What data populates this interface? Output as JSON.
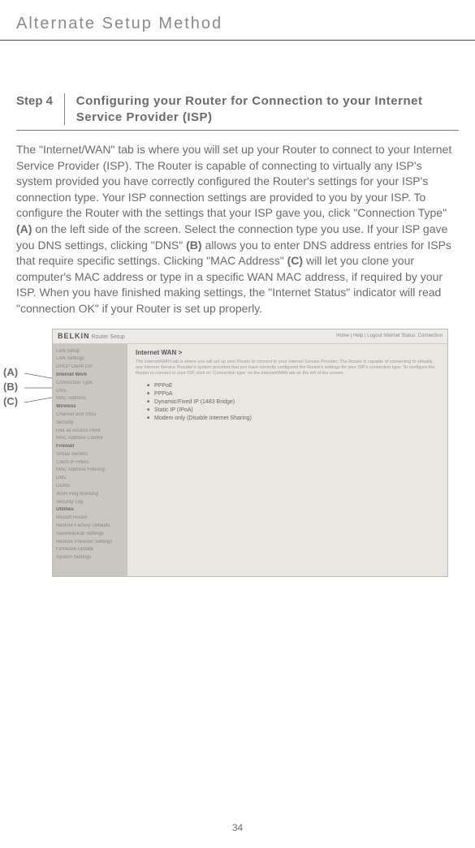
{
  "header": "Alternate Setup Method",
  "step_label": "Step 4",
  "step_title": "Configuring your Router for Connection to your Internet Service Provider (ISP)",
  "paragraph": "The \"Internet/WAN\" tab is where you will set up your Router to connect to your Internet Service Provider (ISP). The Router is capable of connecting to virtually any ISP's system provided you have correctly configured the Router's settings for your ISP's connection type. Your ISP connection settings are provided to you by your ISP. To configure the Router with the settings that your ISP gave you, click \"Connection Type\" ",
  "tagA": "(A)",
  "paragraph2": " on the left side of the screen. Select the connection type you use. If your ISP gave you DNS settings, clicking \"DNS\" ",
  "tagB": "(B)",
  "paragraph3": " allows you to enter DNS address entries for ISPs that require specific settings. Clicking \"MAC Address\" ",
  "tagC": "(C)",
  "paragraph4": " will let you clone your computer's MAC address or type in a specific WAN MAC address, if required by your ISP. When you have finished making settings, the \"Internet Status\" indicator will read \"connection OK\" if your Router is set up properly.",
  "callouts": {
    "a": "(A)",
    "b": "(B)",
    "c": "(C)"
  },
  "screenshot": {
    "brand": "BELKIN",
    "sub_brand": "Router Setup",
    "top_links": "Home | Help | Logout   Internet Status: Connection",
    "nav": [
      "LAN Setup",
      "LAN Settings",
      "DHCP Client List",
      "Internet WAN",
      "Connection Type",
      "DNS",
      "MAC Address",
      "Wireless",
      "Channel and SSID",
      "Security",
      "Use as Access Point",
      "MAC Address Control",
      "Firewall",
      "Virtual Servers",
      "Client IP Filters",
      "MAC Address Filtering",
      "DMZ",
      "DDNS",
      "WAN Ping Blocking",
      "Security Log",
      "Utilities",
      "Restart Router",
      "Restore Factory Defaults",
      "Save/Backup Settings",
      "Restore Previous Settings",
      "Firmware Update",
      "System Settings"
    ],
    "nav_hl": "Internet WAN",
    "content_title": "Internet WAN >",
    "content_text": "The Internet/WAN tab is where you will set up your Router to connect to your Internet Service Provider. The Router is capable of connecting to virtually any Internet Service Provider's system provided that you have correctly configured the Router's settings for your ISP's connection type. To configure the Router to connect to your ISP, click on 'Connection type' on the Internet/WAN tab on the left of the screen.",
    "options": [
      "PPPoE",
      "PPPoA",
      "Dynamic/Fixed IP (1483 Bridge)",
      "Static IP (IPoA)",
      "Modem only (Disable Internet Sharing)"
    ]
  },
  "page_number": "34"
}
